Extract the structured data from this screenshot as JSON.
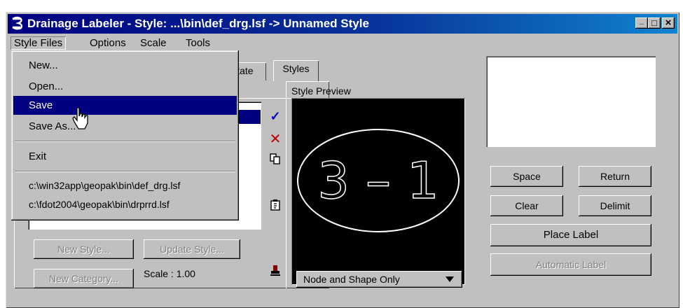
{
  "window": {
    "title": "Drainage Labeler - Style: ...\\bin\\def_drg.lsf -> Unnamed Style",
    "controls": {
      "minimize": "_",
      "maximize": "□",
      "close": "×"
    }
  },
  "menubar": {
    "items": [
      {
        "label": "Style Files"
      },
      {
        "label": "Options"
      },
      {
        "label": "Scale"
      },
      {
        "label": "Tools"
      }
    ]
  },
  "dropdown": {
    "items": [
      {
        "label": "New..."
      },
      {
        "label": "Open..."
      },
      {
        "label": "Save",
        "selected": true
      },
      {
        "label": "Save As..."
      }
    ],
    "exit": {
      "label": "Exit"
    },
    "recent": [
      {
        "label": "c:\\win32app\\geopak\\bin\\def_drg.lsf"
      },
      {
        "label": "c:\\fdot2004\\geopak\\bin\\drprrd.lsf"
      }
    ]
  },
  "tabs": [
    {
      "label": "otate"
    },
    {
      "label": "Styles",
      "active": true
    }
  ],
  "preview": {
    "label": "Style Preview",
    "text": "3 – 1",
    "shape": "Node and Shape Only"
  },
  "buttons": {
    "new_style": "New Style...",
    "update_style": "Update Style...",
    "new_category": "New Category...",
    "space": "Space",
    "return": "Return",
    "clear": "Clear",
    "delimit": "Delimit",
    "place_label": "Place Label",
    "automatic_label": "Automatic Label"
  },
  "scale": {
    "text": "Scale : 1.00"
  },
  "icons": [
    "check-icon",
    "delete-x-icon",
    "copy-icon",
    "paste-icon",
    "stamp-icon"
  ],
  "colors": {
    "title_active": "#000080",
    "menu_selected": "#000080",
    "check": "#0000c0",
    "delete": "#c00000"
  }
}
